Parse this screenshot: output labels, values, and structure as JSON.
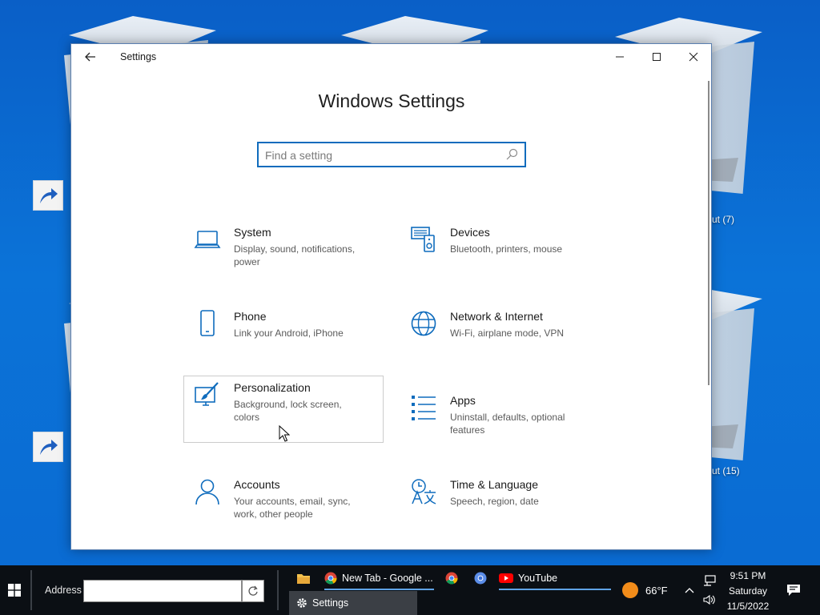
{
  "desktop": {
    "labels": [
      "ut (7)",
      "ut (15)"
    ]
  },
  "window": {
    "title": "Settings",
    "heading": "Windows Settings",
    "search": {
      "placeholder": "Find a setting",
      "value": ""
    }
  },
  "tiles": [
    {
      "name": "System",
      "desc": "Display, sound, notifications, power",
      "icon": "laptop-icon"
    },
    {
      "name": "Devices",
      "desc": "Bluetooth, printers, mouse",
      "icon": "devices-icon"
    },
    {
      "name": "Phone",
      "desc": "Link your Android, iPhone",
      "icon": "phone-icon"
    },
    {
      "name": "Network & Internet",
      "desc": "Wi-Fi, airplane mode, VPN",
      "icon": "globe-icon"
    },
    {
      "name": "Personalization",
      "desc": "Background, lock screen, colors",
      "icon": "paintbrush-icon"
    },
    {
      "name": "Apps",
      "desc": "Uninstall, defaults, optional features",
      "icon": "apps-list-icon"
    },
    {
      "name": "Accounts",
      "desc": "Your accounts, email, sync, work, other people",
      "icon": "person-icon"
    },
    {
      "name": "Time & Language",
      "desc": "Speech, region, date",
      "icon": "time-language-icon"
    }
  ],
  "taskbar": {
    "address_label": "Address",
    "address_value": "",
    "tasks": {
      "chrome_tab": "New Tab - Google ...",
      "youtube": "YouTube",
      "settings": "Settings"
    },
    "weather": "66°F",
    "clock": {
      "time": "9:51 PM",
      "day": "Saturday",
      "date": "11/5/2022"
    }
  },
  "colors": {
    "accent": "#0f6cbd",
    "taskbar": "#0b0f14",
    "desktop": "#0b73d8"
  }
}
